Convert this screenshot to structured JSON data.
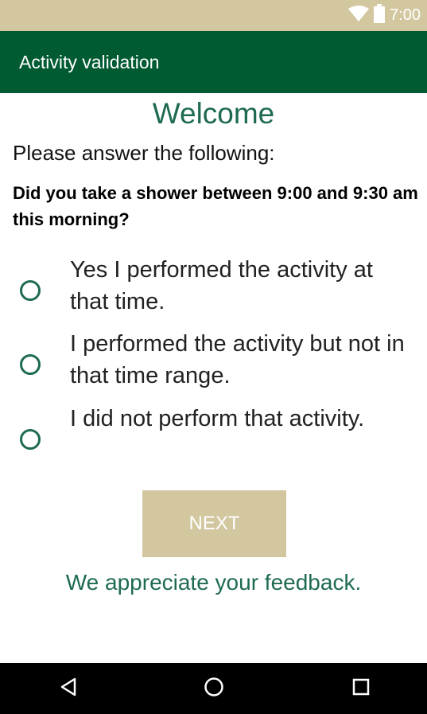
{
  "status_bar": {
    "time": "7:00",
    "icons": [
      "wifi-icon",
      "battery-icon"
    ]
  },
  "app_bar": {
    "title": "Activity validation"
  },
  "welcome": "Welcome",
  "instruction": "Please answer the following:",
  "question": "Did you take a shower between 9:00 and 9:30 am this morning?",
  "options": [
    {
      "label": "Yes I performed the activity at that time.",
      "selected": false
    },
    {
      "label": "I performed the activity but not in that time range.",
      "selected": false
    },
    {
      "label": "I did not perform that activity.",
      "selected": false
    }
  ],
  "next_button": "NEXT",
  "feedback": "We appreciate your feedback.",
  "nav_bar": {
    "icons": [
      "back-icon",
      "home-icon",
      "recents-icon"
    ]
  },
  "colors": {
    "status_bar": "#d2c79f",
    "app_bar": "#005a32",
    "accent": "#1e6b50",
    "button": "#d2c79f",
    "nav_bar": "#000000"
  }
}
